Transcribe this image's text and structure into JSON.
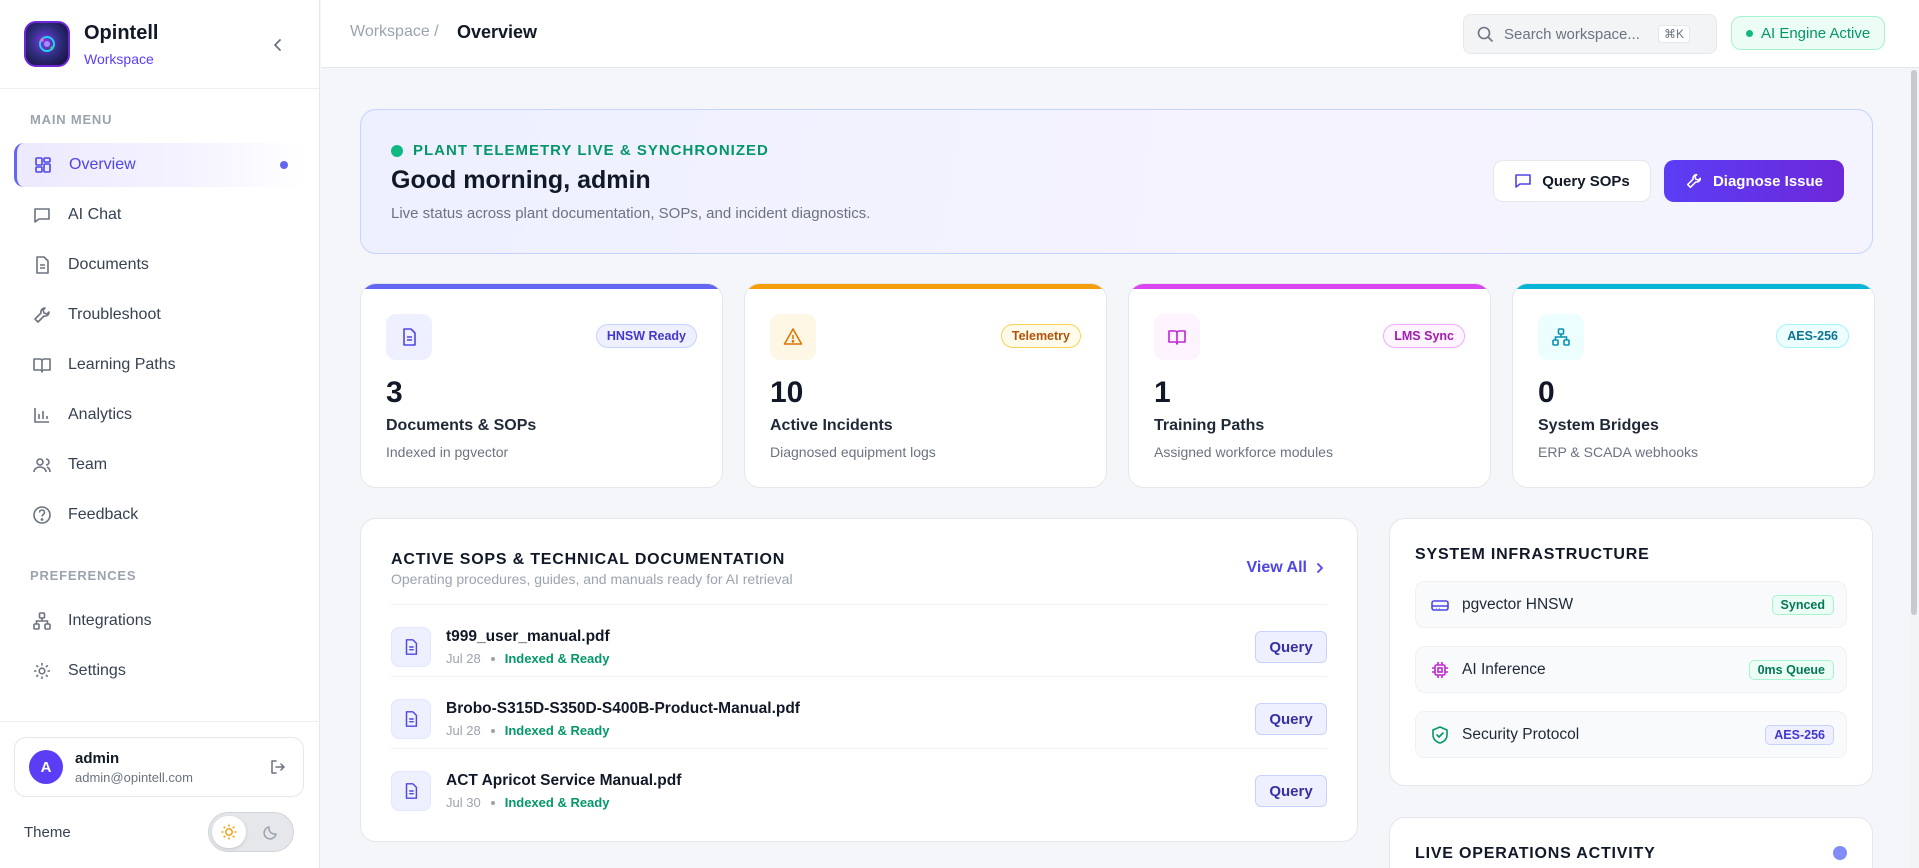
{
  "sidebar": {
    "brand_name": "Opintell",
    "brand_sub": "Workspace",
    "main_menu_label": "MAIN MENU",
    "items": [
      {
        "label": "Overview",
        "icon": "dashboard-icon",
        "active": true
      },
      {
        "label": "AI Chat",
        "icon": "chat-icon"
      },
      {
        "label": "Documents",
        "icon": "document-icon"
      },
      {
        "label": "Troubleshoot",
        "icon": "wrench-icon"
      },
      {
        "label": "Learning Paths",
        "icon": "book-icon"
      },
      {
        "label": "Analytics",
        "icon": "bar-chart-icon"
      },
      {
        "label": "Team",
        "icon": "users-icon"
      },
      {
        "label": "Feedback",
        "icon": "help-circle-icon"
      }
    ],
    "preferences_label": "PREFERENCES",
    "pref_items": [
      {
        "label": "Integrations",
        "icon": "network-icon"
      },
      {
        "label": "Settings",
        "icon": "gear-icon"
      }
    ],
    "user": {
      "initial": "A",
      "name": "admin",
      "email": "admin@opintell.com"
    },
    "theme_label": "Theme"
  },
  "topbar": {
    "breadcrumb_parent": "Workspace /",
    "breadcrumb_current": "Overview",
    "search_placeholder": "Search workspace...",
    "search_shortcut": "⌘K",
    "ai_status": "AI Engine Active"
  },
  "hero": {
    "status": "PLANT TELEMETRY LIVE & SYNCHRONIZED",
    "title": "Good morning, admin",
    "subtitle": "Live status across plant documentation, SOPs, and incident diagnostics.",
    "secondary_button": "Query SOPs",
    "primary_button": "Diagnose Issue"
  },
  "stats": [
    {
      "value": "3",
      "label": "Documents & SOPs",
      "sub": "Indexed in pgvector",
      "badge": "HNSW Ready",
      "icon": "document-icon",
      "accent": "#6366f1"
    },
    {
      "value": "10",
      "label": "Active Incidents",
      "sub": "Diagnosed equipment logs",
      "badge": "Telemetry",
      "icon": "warning-icon",
      "accent": "#f59e0b"
    },
    {
      "value": "1",
      "label": "Training Paths",
      "sub": "Assigned workforce modules",
      "badge": "LMS Sync",
      "icon": "book-icon",
      "accent": "#d946ef"
    },
    {
      "value": "0",
      "label": "System Bridges",
      "sub": "ERP & SCADA webhooks",
      "badge": "AES-256",
      "icon": "network-icon",
      "accent": "#06b6d4"
    }
  ],
  "docs": {
    "title": "ACTIVE SOPS & TECHNICAL DOCUMENTATION",
    "subtitle": "Operating procedures, guides, and manuals ready for AI retrieval",
    "view_all": "View All",
    "rows": [
      {
        "name": "t999_user_manual.pdf",
        "date": "Jul 28",
        "status": "Indexed & Ready",
        "action": "Query"
      },
      {
        "name": "Brobo-S315D-S350D-S400B-Product-Manual.pdf",
        "date": "Jul 28",
        "status": "Indexed & Ready",
        "action": "Query"
      },
      {
        "name": "ACT Apricot Service Manual.pdf",
        "date": "Jul 30",
        "status": "Indexed & Ready",
        "action": "Query"
      }
    ]
  },
  "infra": {
    "title": "SYSTEM INFRASTRUCTURE",
    "rows": [
      {
        "name": "pgvector HNSW",
        "tag": "Synced",
        "icon": "database-icon"
      },
      {
        "name": "AI Inference",
        "tag": "0ms Queue",
        "icon": "cpu-icon"
      },
      {
        "name": "Security Protocol",
        "tag": "AES-256",
        "icon": "shield-icon"
      }
    ]
  },
  "live": {
    "title": "LIVE OPERATIONS ACTIVITY"
  },
  "colors": {
    "brand": "#5b3df5",
    "success": "#10b981",
    "warning": "#f59e0b",
    "magenta": "#d946ef",
    "cyan": "#06b6d4"
  }
}
